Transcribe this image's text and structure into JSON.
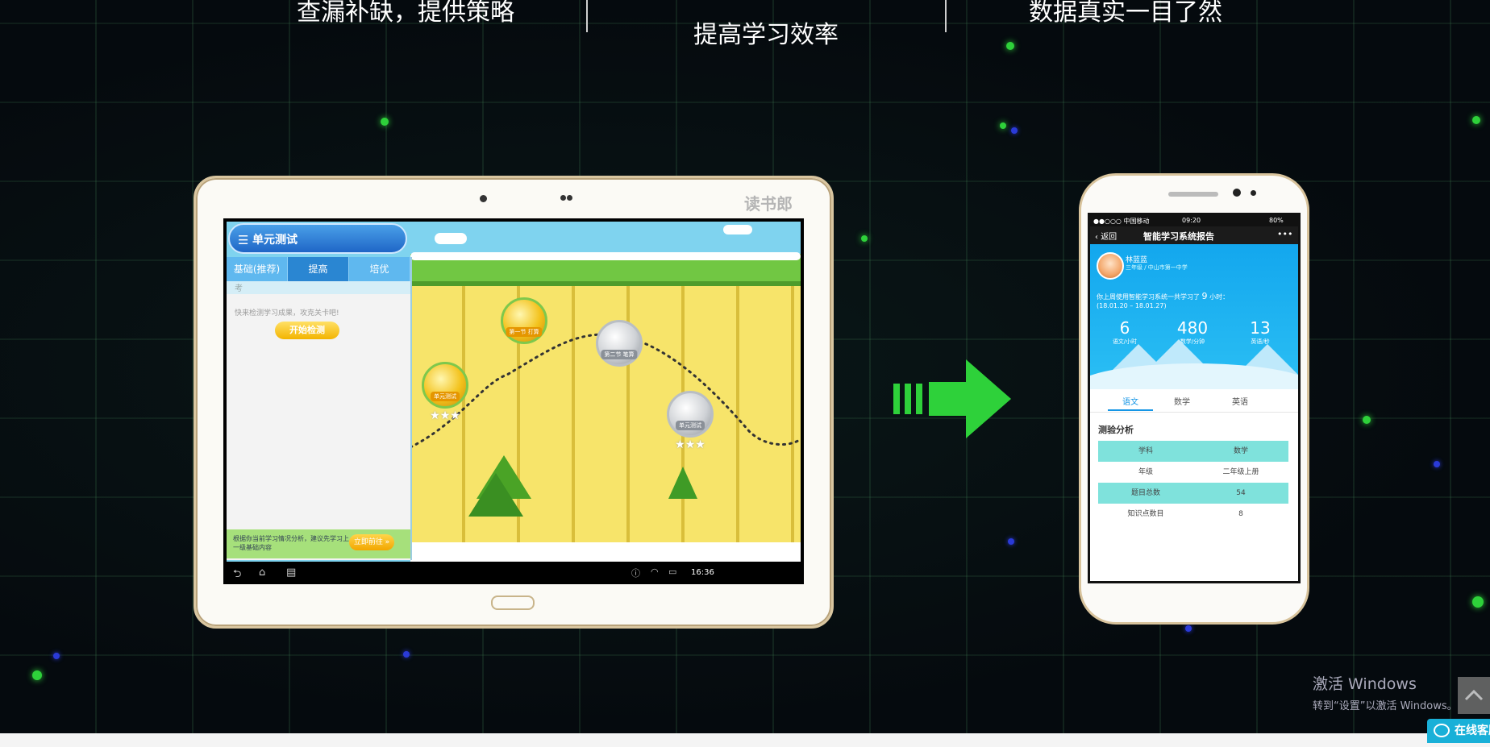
{
  "page": {
    "headlines": [
      "查漏补缺，提供策略",
      "提高学习效率",
      "数据真实一目了然"
    ]
  },
  "tablet": {
    "brand": "读书郎",
    "app": {
      "title": "单元测试",
      "tabs": [
        "基础(推荐)",
        "提高",
        "培优"
      ],
      "active_tab": 1,
      "subbar": "考",
      "hint": "快来检测学习成果，攻克关卡吧!",
      "start_button": "开始检测",
      "advice": "根据你当前学习情况分析，建议先学习上一级基础内容",
      "advice_button": "立即前往 »",
      "medals": [
        {
          "label": "单元测试",
          "kind": "gold",
          "stars": "★★★"
        },
        {
          "label": "第一节 打算",
          "kind": "gold",
          "stars": ""
        },
        {
          "label": "第二节 笔算",
          "kind": "silver",
          "stars": ""
        },
        {
          "label": "单元测试",
          "kind": "silver",
          "stars": "★★★"
        }
      ]
    },
    "navbar": {
      "time": "16:36"
    }
  },
  "phone": {
    "status": {
      "carrier": "●●○○○ 中国移动",
      "time": "09:20",
      "battery": "80%"
    },
    "back": "返回",
    "title": "智能学习系统报告",
    "more": "•••",
    "student": {
      "name": "林蓝蓝",
      "info": "三年级 / 中山市第一中学"
    },
    "summary_prefix": "你上周使用智能学习系统一共学习了",
    "summary_hours": "9",
    "summary_suffix": "小时：",
    "summary_range": "(18.01.20 – 18.01.27)",
    "stats": [
      {
        "value": "6",
        "unit": "语文/小时"
      },
      {
        "value": "480",
        "unit": "数学/分钟"
      },
      {
        "value": "13",
        "unit": "英语/秒"
      }
    ],
    "tabs": [
      "语文",
      "数学",
      "英语"
    ],
    "active_tab": 0,
    "section": "测验分析",
    "table": [
      [
        "学科",
        "数学"
      ],
      [
        "年级",
        "二年级上册"
      ],
      [
        "题目总数",
        "54"
      ],
      [
        "知识点数目",
        "8"
      ]
    ]
  },
  "watermark": {
    "line1": "激活 Windows",
    "line2": "转到“设置”以激活 Windows。"
  },
  "chat_button": "在线客服",
  "colors": {
    "accent_green": "#2ed13a",
    "phone_blue": "#13a7ee",
    "chat": "#19b0d8"
  }
}
